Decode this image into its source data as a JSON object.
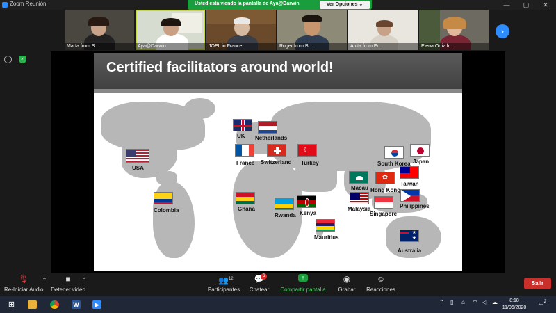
{
  "window": {
    "title": "Zoom Reunión",
    "minimize": "—",
    "maximize": "▢",
    "close": "✕"
  },
  "share_banner": {
    "text": "Usted está viendo la pantalla de Aya@Darwin",
    "view_options": "Ver Opciones ⌄"
  },
  "participants": [
    {
      "name": "María from S…",
      "muted": true
    },
    {
      "name": "Aya@Darwin",
      "muted": false
    },
    {
      "name": "JOEL in France",
      "muted": false
    },
    {
      "name": "Roger from B…",
      "muted": true
    },
    {
      "name": "Anita from Ec…",
      "muted": true
    },
    {
      "name": "Elena Ortiz fr…",
      "muted": true
    }
  ],
  "slide": {
    "title": "Certified facilitators around world!",
    "countries": [
      "UK",
      "Netherlands",
      "France",
      "Switzerland",
      "Turkey",
      "USA",
      "South Korea",
      "Japan",
      "Macau",
      "Hong Kong",
      "Taiwan",
      "Colombia",
      "Ghana",
      "Rwanda",
      "Kenya",
      "Malaysia",
      "Singapore",
      "Philippines",
      "Mauritius",
      "Australia"
    ]
  },
  "toolbar": {
    "audio": "Re-Iniciar Audio",
    "video": "Detener video",
    "participants": "Participantes",
    "participants_count": "12",
    "chat": "Chatear",
    "chat_badge": "6",
    "share": "Compartir pantalla",
    "record": "Grabar",
    "reactions": "Reacciones",
    "leave": "Salir"
  },
  "taskbar": {
    "time": "8:18",
    "date": "11/06/2020",
    "notifications": "2"
  },
  "colors": {
    "share_green": "#1a9d3c",
    "zoom_blue": "#2d8cff",
    "leave_red": "#c9302c"
  }
}
